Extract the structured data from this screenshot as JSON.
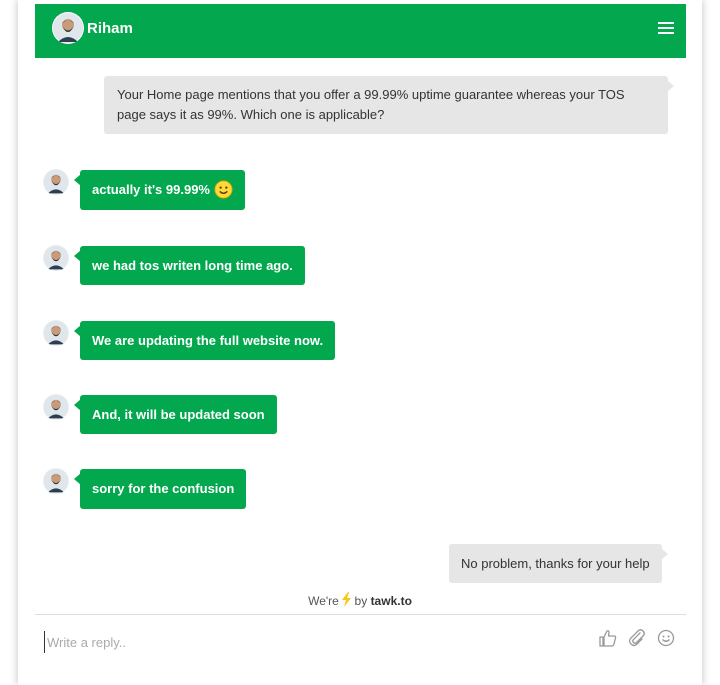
{
  "header": {
    "agent_name": "Riham",
    "color": "#03a84e"
  },
  "messages": [
    {
      "from": "visitor",
      "text": "Your Home page mentions that you offer a 99.99% uptime guarantee whereas your TOS page says it as 99%. Which one is applicable?"
    },
    {
      "from": "agent",
      "text": "actually it's 99.99%",
      "emoji": "smiley-icon"
    },
    {
      "from": "agent",
      "text": "we had tos writen long time ago."
    },
    {
      "from": "agent",
      "text": "We are updating the full website now."
    },
    {
      "from": "agent",
      "text": "And, it will be updated soon"
    },
    {
      "from": "agent",
      "text": "sorry for the confusion"
    },
    {
      "from": "visitor",
      "text": "No problem, thanks for your help"
    }
  ],
  "branding": {
    "prefix": "We're",
    "icon": "lightning-icon",
    "by": "by",
    "brand": "tawk.to"
  },
  "composer": {
    "placeholder": "Write a reply..",
    "icons": [
      "thumbs-up-icon",
      "paperclip-icon",
      "emoji-icon"
    ]
  },
  "colors": {
    "agent_bubble": "#03a84e",
    "visitor_bubble": "#e6e6e6",
    "lightning": "#f5c518"
  }
}
